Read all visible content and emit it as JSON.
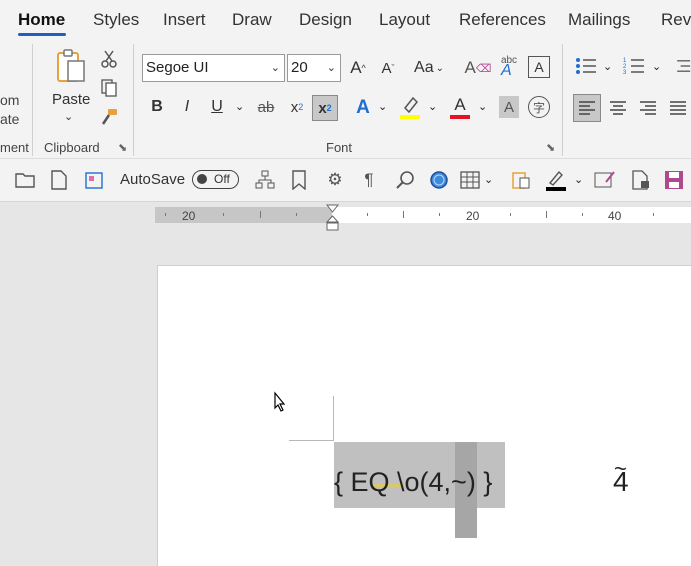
{
  "tabs": [
    "Home",
    "Styles",
    "Insert",
    "Draw",
    "Design",
    "Layout",
    "References",
    "Mailings",
    "Revi"
  ],
  "ribbon": {
    "clipboard": {
      "cut_partial_1": "om",
      "cut_partial_2": "ate",
      "left_group_label": "ment",
      "paste_label": "Paste",
      "group_label": "Clipboard"
    },
    "font": {
      "font_name": "Segoe UI",
      "font_size": "20",
      "group_label": "Font",
      "grow_label": "A",
      "shrink_label": "A",
      "case_label": "Aa",
      "bold": "B",
      "italic": "I",
      "underline": "U",
      "strike": "ab",
      "subscript": "x",
      "superscript": "x",
      "text_effects": "A",
      "font_color": "A",
      "shading": "A",
      "highlight_color": "#ffff00",
      "font_color_value": "#e81123"
    }
  },
  "qat": {
    "autosave_label": "AutoSave",
    "autosave_state": "Off"
  },
  "ruler": {
    "labels": [
      "20",
      "20",
      "40"
    ]
  },
  "document": {
    "field_code": "{ EQ \\o(4,~) }",
    "result_base": "4",
    "result_mark": "~"
  }
}
